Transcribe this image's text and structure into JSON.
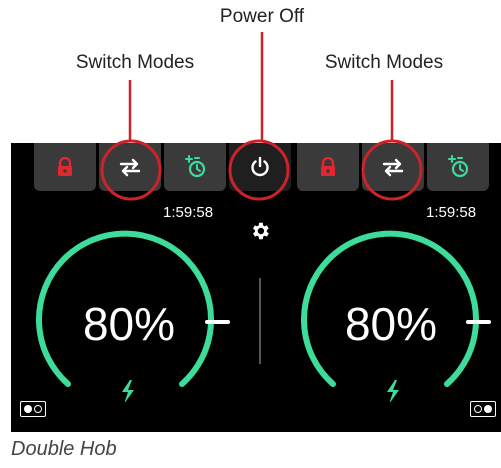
{
  "annotations": {
    "power_off": "Power Off",
    "switch_modes_left": "Switch Modes",
    "switch_modes_right": "Switch Modes"
  },
  "left_hob": {
    "timer": "1:59:58",
    "power_percent": "80%",
    "icons": [
      "lock-icon",
      "swap-arrows-icon",
      "timer-add-icon"
    ]
  },
  "right_hob": {
    "timer": "1:59:58",
    "power_percent": "80%",
    "icons": [
      "lock-icon",
      "swap-arrows-icon",
      "timer-add-icon"
    ]
  },
  "center": {
    "icons": [
      "power-icon",
      "gear-icon"
    ]
  },
  "caption": "Double Hob",
  "colors": {
    "accent_green": "#3ddc9b",
    "lock_red": "#e3262f",
    "callout_red": "#cc2229",
    "tab_gray": "#3a3a3a"
  }
}
